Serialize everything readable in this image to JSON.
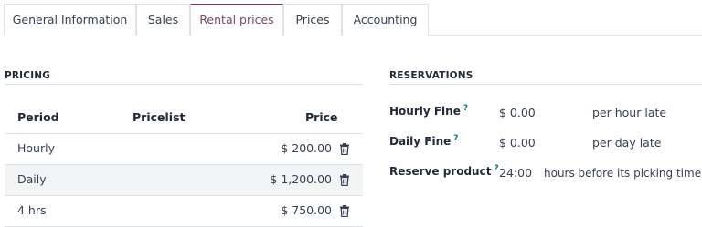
{
  "tabs": [
    {
      "label": "General Information"
    },
    {
      "label": "Sales"
    },
    {
      "label": "Rental prices",
      "active": true
    },
    {
      "label": "Prices"
    },
    {
      "label": "Accounting"
    }
  ],
  "pricing": {
    "title": "PRICING",
    "columns": {
      "period": "Period",
      "pricelist": "Pricelist",
      "price": "Price"
    },
    "rows": [
      {
        "period": "Hourly",
        "pricelist": "",
        "price": "$ 200.00"
      },
      {
        "period": "Daily",
        "pricelist": "",
        "price": "$ 1,200.00"
      },
      {
        "period": "4 hrs",
        "pricelist": "",
        "price": "$ 750.00"
      }
    ]
  },
  "reservations": {
    "title": "RESERVATIONS",
    "hourly_fine": {
      "label": "Hourly Fine",
      "help": "?",
      "value": "$ 0.00",
      "unit": "per hour late"
    },
    "daily_fine": {
      "label": "Daily Fine",
      "help": "?",
      "value": "$ 0.00",
      "unit": "per day late"
    },
    "reserve_product": {
      "label": "Reserve product",
      "help": "?",
      "value": "24:00",
      "unit": "hours before its picking time",
      "unit_help": "?"
    }
  },
  "colors": {
    "accent": "#714b67",
    "help": "#017e84",
    "border": "#dee2e6",
    "row_alt": "#f3f4f6"
  },
  "icons": {
    "delete": "trash-icon"
  }
}
